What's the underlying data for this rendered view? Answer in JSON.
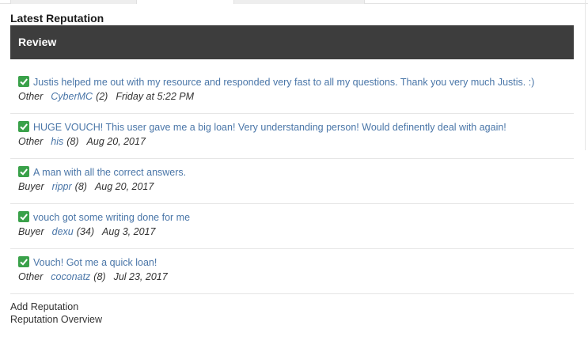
{
  "section_title": "Latest Reputation",
  "table_header": "Review",
  "reputations": [
    {
      "comment": "Justis helped me out with my resource and responded very fast to all my questions. Thank you very much Justis. :)",
      "type": "Other",
      "user": "CyberMC",
      "count": "(2)",
      "date": "Friday at 5:22 PM"
    },
    {
      "comment": "HUGE VOUCH! This user gave me a big loan! Very understanding person! Would definently deal with again!",
      "type": "Other",
      "user": "his",
      "count": "(8)",
      "date": "Aug 20, 2017"
    },
    {
      "comment": "A man with all the correct answers.",
      "type": "Buyer",
      "user": "rippr",
      "count": "(8)",
      "date": "Aug 20, 2017"
    },
    {
      "comment": "vouch got some writing done for me",
      "type": "Buyer",
      "user": "dexu",
      "count": "(34)",
      "date": "Aug 3, 2017"
    },
    {
      "comment": "Vouch! Got me a quick loan!",
      "type": "Other",
      "user": "coconatz",
      "count": "(8)",
      "date": "Jul 23, 2017"
    }
  ],
  "links": {
    "add_reputation": "Add Reputation",
    "reputation_overview": "Reputation Overview"
  },
  "colors": {
    "header_bg": "#3d3d3d",
    "link": "#4a76a8",
    "check": "#3aa14a"
  },
  "icons": {
    "positive": "check-icon"
  }
}
